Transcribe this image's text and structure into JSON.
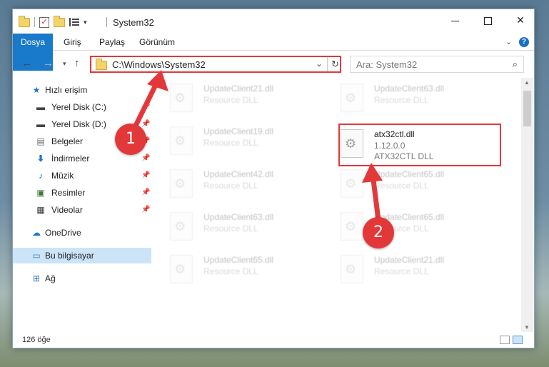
{
  "window": {
    "title": "System32",
    "controls": {
      "minimize": "minimize",
      "maximize": "maximize",
      "close": "✕"
    }
  },
  "ribbon": {
    "tabs": [
      "Dosya",
      "Giriş",
      "Paylaş",
      "Görünüm"
    ],
    "help": "?"
  },
  "navigation": {
    "address": "C:\\Windows\\System32",
    "search_placeholder": "Ara: System32"
  },
  "sidebar": {
    "items": [
      {
        "label": "Hızlı erişim",
        "icon": "star-icon"
      },
      {
        "label": "Yerel Disk (C:)",
        "icon": "drive-icon"
      },
      {
        "label": "Yerel Disk (D:)",
        "icon": "drive-icon"
      },
      {
        "label": "Belgeler",
        "icon": "documents-icon"
      },
      {
        "label": "İndirmeler",
        "icon": "download-icon"
      },
      {
        "label": "Müzik",
        "icon": "music-icon"
      },
      {
        "label": "Resimler",
        "icon": "pictures-icon"
      },
      {
        "label": "Videolar",
        "icon": "videos-icon"
      },
      {
        "label": "OneDrive",
        "icon": "cloud-icon"
      },
      {
        "label": "Bu bilgisayar",
        "icon": "computer-icon"
      },
      {
        "label": "Ağ",
        "icon": "network-icon"
      }
    ]
  },
  "files": [
    {
      "name": "UpdateClient21.dll",
      "type": "Resource DLL"
    },
    {
      "name": "UpdateClient63.dll",
      "type": "Resource DLL"
    },
    {
      "name": "UpdateClient19.dll",
      "type": "Resource DLL"
    },
    {
      "name": "atx32ctl.dll",
      "version": "1.12.0.0",
      "type": "ATX32CTL DLL"
    },
    {
      "name": "UpdateClient42.dll",
      "type": "Resource DLL"
    },
    {
      "name": "UpdateClient65.dll",
      "type": "Resource DLL"
    },
    {
      "name": "UpdateClient63.dll",
      "type": "Resource DLL"
    },
    {
      "name": "UpdateClient65.dll",
      "type": "Resource DLL"
    },
    {
      "name": "UpdateClient65.dll",
      "type": "Resource DLL"
    },
    {
      "name": "UpdateClient21.dll",
      "type": "Resource DLL"
    }
  ],
  "status": {
    "item_count": "126 öğe"
  },
  "callouts": [
    "1",
    "2"
  ],
  "colors": {
    "accent": "#1979ca",
    "annotation": "#e3383a",
    "selected": "#cce4f7"
  }
}
